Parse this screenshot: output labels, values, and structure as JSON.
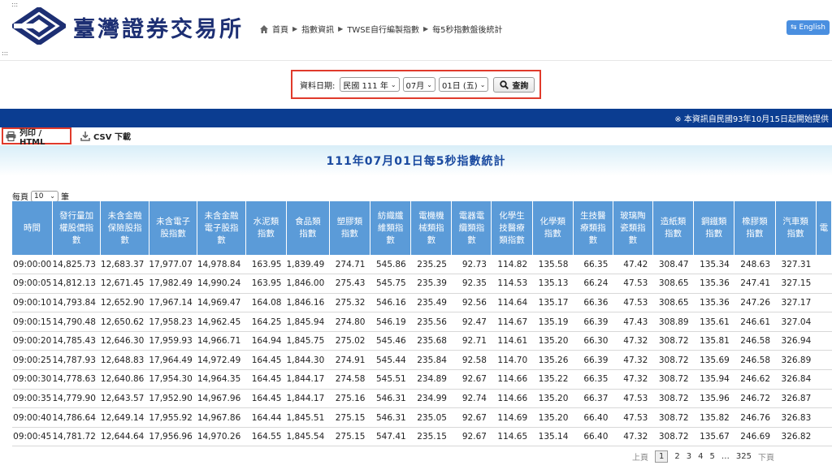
{
  "header": {
    "logo_text": "臺灣證券交易所",
    "breadcrumb": [
      "首頁",
      "指數資訊",
      "TWSE自行編製指數",
      "每5秒指數盤後統計"
    ],
    "lang_button": "English"
  },
  "search": {
    "label": "資料日期:",
    "year": "民國 111 年",
    "month": "07月",
    "day": "01日 (五)",
    "query_button": "查詢"
  },
  "notice": "※ 本資訊自民國93年10月15日起開始提供",
  "toolbar": {
    "print_label": "列印 / HTML",
    "csv_label": "CSV 下載"
  },
  "report_title": "111年07月01日每5秒指數統計",
  "per_page": {
    "prefix": "每頁",
    "value": "10",
    "suffix": "筆"
  },
  "table": {
    "headers": [
      [
        "時間"
      ],
      [
        "發行量加",
        "權股價指",
        "數"
      ],
      [
        "未含金融",
        "保險股指",
        "數"
      ],
      [
        "未含電子",
        "股指數"
      ],
      [
        "未含金融",
        "電子股指",
        "數"
      ],
      [
        "水泥類",
        "指數"
      ],
      [
        "食品類",
        "指數"
      ],
      [
        "塑膠類",
        "指數"
      ],
      [
        "紡織纖",
        "維類指",
        "數"
      ],
      [
        "電機機",
        "械類指",
        "數"
      ],
      [
        "電器電",
        "纜類指",
        "數"
      ],
      [
        "化學生",
        "技醫療",
        "類指數"
      ],
      [
        "化學類",
        "指數"
      ],
      [
        "生技醫",
        "療類指",
        "數"
      ],
      [
        "玻璃陶",
        "瓷類指",
        "數"
      ],
      [
        "造紙類",
        "指數"
      ],
      [
        "鋼鐵類",
        "指數"
      ],
      [
        "橡膠類",
        "指數"
      ],
      [
        "汽車類",
        "指數"
      ],
      [
        "電"
      ]
    ],
    "rows": [
      [
        "09:00:00",
        "14,825.73",
        "12,683.37",
        "17,977.07",
        "14,978.84",
        "163.95",
        "1,839.49",
        "274.71",
        "545.86",
        "235.25",
        "92.73",
        "114.82",
        "135.58",
        "66.35",
        "47.42",
        "308.47",
        "135.34",
        "248.63",
        "327.31"
      ],
      [
        "09:00:05",
        "14,812.13",
        "12,671.45",
        "17,982.49",
        "14,990.24",
        "163.95",
        "1,846.00",
        "275.43",
        "545.75",
        "235.39",
        "92.35",
        "114.53",
        "135.13",
        "66.24",
        "47.53",
        "308.65",
        "135.36",
        "247.41",
        "327.15"
      ],
      [
        "09:00:10",
        "14,793.84",
        "12,652.90",
        "17,967.14",
        "14,969.47",
        "164.08",
        "1,846.16",
        "275.32",
        "546.16",
        "235.49",
        "92.56",
        "114.64",
        "135.17",
        "66.36",
        "47.53",
        "308.65",
        "135.36",
        "247.26",
        "327.17"
      ],
      [
        "09:00:15",
        "14,790.48",
        "12,650.62",
        "17,958.23",
        "14,962.45",
        "164.25",
        "1,845.94",
        "274.80",
        "546.19",
        "235.56",
        "92.47",
        "114.67",
        "135.19",
        "66.39",
        "47.43",
        "308.89",
        "135.61",
        "246.61",
        "327.04"
      ],
      [
        "09:00:20",
        "14,785.43",
        "12,646.30",
        "17,959.93",
        "14,966.71",
        "164.94",
        "1,845.75",
        "275.02",
        "545.46",
        "235.68",
        "92.71",
        "114.61",
        "135.20",
        "66.30",
        "47.32",
        "308.72",
        "135.81",
        "246.58",
        "326.94"
      ],
      [
        "09:00:25",
        "14,787.93",
        "12,648.83",
        "17,964.49",
        "14,972.49",
        "164.45",
        "1,844.30",
        "274.91",
        "545.44",
        "235.84",
        "92.58",
        "114.70",
        "135.26",
        "66.39",
        "47.32",
        "308.72",
        "135.69",
        "246.58",
        "326.89"
      ],
      [
        "09:00:30",
        "14,778.63",
        "12,640.86",
        "17,954.30",
        "14,964.35",
        "164.45",
        "1,844.17",
        "274.58",
        "545.51",
        "234.89",
        "92.67",
        "114.66",
        "135.22",
        "66.35",
        "47.32",
        "308.72",
        "135.94",
        "246.62",
        "326.84"
      ],
      [
        "09:00:35",
        "14,779.90",
        "12,643.57",
        "17,952.90",
        "14,967.96",
        "164.45",
        "1,844.17",
        "275.16",
        "546.31",
        "234.99",
        "92.74",
        "114.66",
        "135.20",
        "66.37",
        "47.53",
        "308.72",
        "135.96",
        "246.72",
        "326.87"
      ],
      [
        "09:00:40",
        "14,786.64",
        "12,649.14",
        "17,955.92",
        "14,967.86",
        "164.44",
        "1,845.51",
        "275.15",
        "546.31",
        "235.05",
        "92.67",
        "114.69",
        "135.20",
        "66.40",
        "47.53",
        "308.72",
        "135.82",
        "246.76",
        "326.83"
      ],
      [
        "09:00:45",
        "14,781.72",
        "12,644.64",
        "17,956.96",
        "14,970.26",
        "164.55",
        "1,845.54",
        "275.15",
        "547.41",
        "235.15",
        "92.67",
        "114.65",
        "135.14",
        "66.40",
        "47.32",
        "308.72",
        "135.67",
        "246.69",
        "326.82"
      ]
    ]
  },
  "pager": {
    "prev": "上頁",
    "pages": [
      "1",
      "2",
      "3",
      "4",
      "5"
    ],
    "ellipsis": "…",
    "last": "325",
    "next": "下頁"
  }
}
